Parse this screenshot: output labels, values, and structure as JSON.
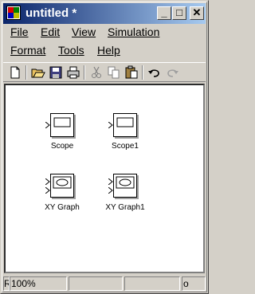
{
  "window": {
    "title": "untitled *",
    "controls": {
      "minimize": "_",
      "maximize": "□",
      "close": "✕"
    }
  },
  "menu": {
    "row1": [
      "File",
      "Edit",
      "View",
      "Simulation"
    ],
    "row2": [
      "Format",
      "Tools",
      "Help"
    ]
  },
  "toolbar": {
    "buttons": [
      "new-icon",
      "open-icon",
      "save-icon",
      "print-icon",
      "cut-icon",
      "copy-icon",
      "paste-icon",
      "undo-icon",
      "redo-icon"
    ]
  },
  "blocks": [
    {
      "label": "Scope",
      "kind": "scope"
    },
    {
      "label": "Scope1",
      "kind": "scope"
    },
    {
      "label": "XY Graph",
      "kind": "xygraph"
    },
    {
      "label": "XY Graph1",
      "kind": "xygraph"
    }
  ],
  "status": {
    "left": "Re",
    "zoom": "100%",
    "right": "o"
  }
}
